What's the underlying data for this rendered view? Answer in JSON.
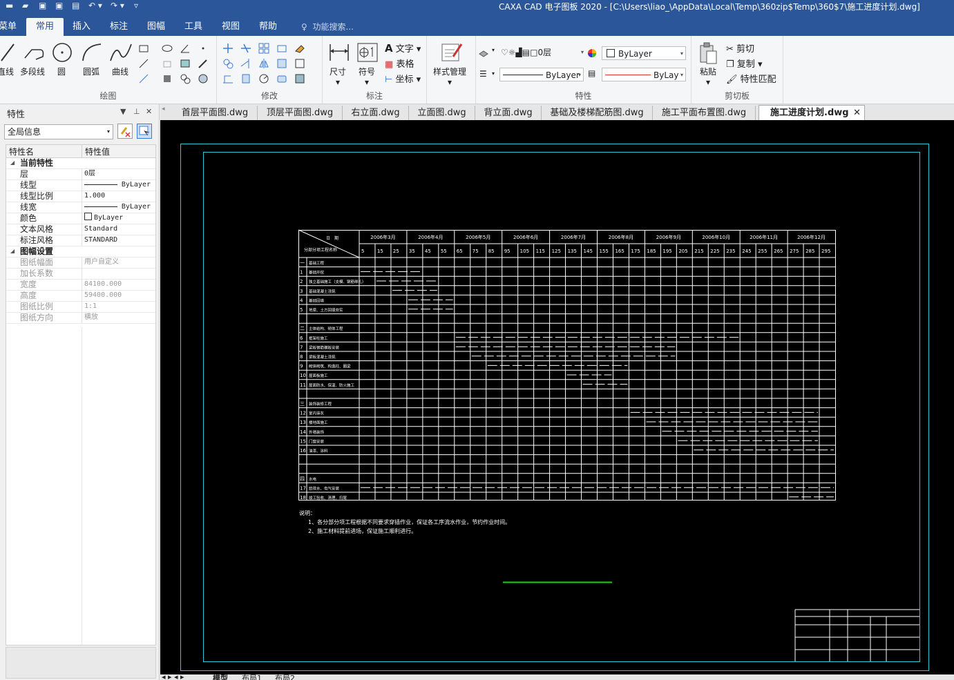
{
  "window": {
    "title": "CAXA CAD 电子图板 2020 - [C:\\Users\\liao_\\AppData\\Local\\Temp\\360zip$Temp\\360$7\\施工进度计划.dwg]"
  },
  "ribbon_tabs": [
    {
      "label": "菜单"
    },
    {
      "label": "常用"
    },
    {
      "label": "插入"
    },
    {
      "label": "标注"
    },
    {
      "label": "图幅"
    },
    {
      "label": "工具"
    },
    {
      "label": "视图"
    },
    {
      "label": "帮助"
    }
  ],
  "search": {
    "placeholder": "功能搜索..."
  },
  "groups": {
    "draw": {
      "title": "绘图",
      "buttons": [
        "直线",
        "多段线",
        "圆",
        "圆弧",
        "曲线"
      ]
    },
    "modify": {
      "title": "修改"
    },
    "annotate": {
      "title": "标注",
      "buttons": [
        "尺寸",
        "符号"
      ],
      "small": [
        "文字",
        "表格",
        "坐标"
      ]
    },
    "style": {
      "label": "样式管理"
    },
    "properties": {
      "title": "特性",
      "layer": "0层",
      "color": "ByLayer",
      "linetype": "ByLayer",
      "lineweight": "ByLay"
    },
    "clipboard": {
      "title": "剪切板",
      "paste": "粘贴",
      "items": [
        "剪切",
        "复制",
        "特性匹配"
      ]
    }
  },
  "panel": {
    "title": "特性",
    "scope": "全局信息",
    "col_name": "特性名",
    "col_value": "特性值",
    "section_current": "当前特性",
    "section_sheet": "图幅设置",
    "rows_current": [
      {
        "name": "层",
        "value": "0层"
      },
      {
        "name": "线型",
        "value": "ByLayer"
      },
      {
        "name": "线型比例",
        "value": "1.000"
      },
      {
        "name": "线宽",
        "value": "ByLayer"
      },
      {
        "name": "颜色",
        "value": "ByLayer"
      },
      {
        "name": "文本风格",
        "value": "Standard"
      },
      {
        "name": "标注风格",
        "value": "STANDARD"
      }
    ],
    "rows_sheet": [
      {
        "name": "图纸幅面",
        "value": "用户自定义"
      },
      {
        "name": "加长系数",
        "value": ""
      },
      {
        "name": "宽度",
        "value": "84100.000"
      },
      {
        "name": "高度",
        "value": "59400.000"
      },
      {
        "name": "图纸比例",
        "value": "1:1"
      },
      {
        "name": "图纸方向",
        "value": "横放"
      }
    ]
  },
  "doc_tabs": [
    {
      "label": "首层平面图.dwg"
    },
    {
      "label": "顶层平面图.dwg"
    },
    {
      "label": "右立面.dwg"
    },
    {
      "label": "立面图.dwg"
    },
    {
      "label": "背立面.dwg"
    },
    {
      "label": "基础及楼梯配筋图.dwg"
    },
    {
      "label": "施工平面布置图.dwg"
    },
    {
      "label": "施工进度计划.dwg",
      "active": true
    }
  ],
  "layout_tabs": [
    "模型",
    "布局1",
    "布局2"
  ],
  "drawing": {
    "header_left_top": "日　期",
    "header_left_bottom": "分部分项工程名称",
    "months": [
      "2006年3月",
      "2006年4月",
      "2006年5月",
      "2006年6月",
      "2006年7月",
      "2006年8月",
      "2006年9月",
      "2006年10月",
      "2006年11月",
      "2006年12月"
    ],
    "days": [
      "5",
      "15",
      "25",
      "35",
      "45",
      "55",
      "65",
      "75",
      "85",
      "95",
      "105",
      "115",
      "125",
      "135",
      "145",
      "155",
      "165",
      "175",
      "185",
      "195",
      "205",
      "215",
      "225",
      "235",
      "245",
      "255",
      "265",
      "275",
      "285",
      "295"
    ],
    "rows": [
      {
        "no": "一",
        "task": "基础工程"
      },
      {
        "no": "1",
        "task": "基础开挖"
      },
      {
        "no": "2",
        "task": "独立基础施工（支模、钢筋绑扎）"
      },
      {
        "no": "3",
        "task": "基础混凝土浇筑"
      },
      {
        "no": "4",
        "task": "基础回填"
      },
      {
        "no": "5",
        "task": "地梁、土方回填夯实"
      },
      {
        "no": "二",
        "task": "主体结构、砌体工程"
      },
      {
        "no": "6",
        "task": "框架柱施工"
      },
      {
        "no": "7",
        "task": "梁板钢筋模板安装"
      },
      {
        "no": "8",
        "task": "梁板混凝土浇筑"
      },
      {
        "no": "9",
        "task": "砌体砌筑、构造柱、圈梁"
      },
      {
        "no": "10",
        "task": "屋面板施工"
      },
      {
        "no": "11",
        "task": "屋面防水、保温、防火施工"
      },
      {
        "no": "三",
        "task": "装饰装修工程"
      },
      {
        "no": "12",
        "task": "室内抹灰"
      },
      {
        "no": "13",
        "task": "楼地面施工"
      },
      {
        "no": "14",
        "task": "外墙装饰"
      },
      {
        "no": "15",
        "task": "门窗安装"
      },
      {
        "no": "16",
        "task": "油漆、涂料"
      },
      {
        "no": "四",
        "task": "水电"
      },
      {
        "no": "17",
        "task": "给排水、电气安装"
      },
      {
        "no": "18",
        "task": "竣工验收、清理、扫尾"
      }
    ],
    "note_title": "说明：",
    "notes": [
      "1、各分部分项工程根据不同要求穿插作业，保证各工序流水作业，节约作业时间。",
      "2、施工材料提前进场，保证施工顺利进行。"
    ]
  }
}
